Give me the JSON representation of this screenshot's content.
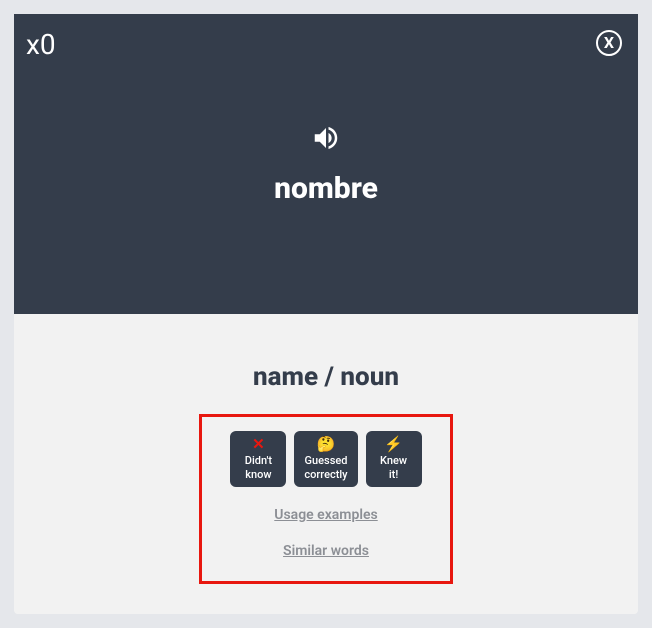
{
  "counter": "x0",
  "close_icon_label": "X",
  "word": "nombre",
  "translation": "name / noun",
  "buttons": {
    "didnt_know": {
      "label": "Didn't\nknow"
    },
    "guessed": {
      "label": "Guessed\ncorrectly",
      "emoji": "🤔"
    },
    "knew": {
      "label": "Knew\nit!"
    }
  },
  "links": {
    "usage": "Usage examples",
    "similar": "Similar words"
  }
}
